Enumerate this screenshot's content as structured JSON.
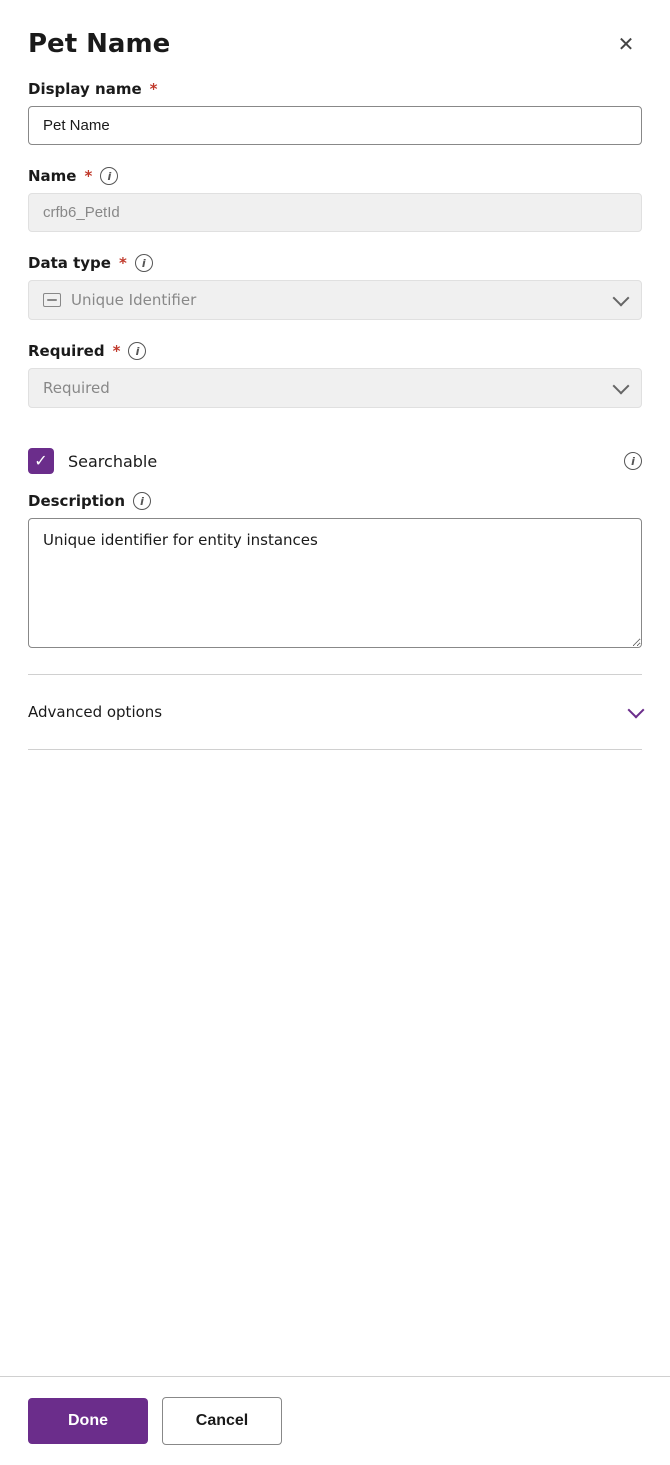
{
  "panel": {
    "title": "Pet Name",
    "close_label": "×"
  },
  "fields": {
    "display_name": {
      "label": "Display name",
      "required": true,
      "value": "Pet Name",
      "placeholder": "Pet Name"
    },
    "name": {
      "label": "Name",
      "required": true,
      "info": true,
      "value": "crfb6_PetId",
      "placeholder": "crfb6_PetId",
      "disabled": true
    },
    "data_type": {
      "label": "Data type",
      "required": true,
      "info": true,
      "value": "Unique Identifier",
      "placeholder": "Unique Identifier"
    },
    "required": {
      "label": "Required",
      "required": true,
      "info": true,
      "value": "Required",
      "placeholder": "Required"
    },
    "searchable": {
      "label": "Searchable",
      "checked": true
    },
    "description": {
      "label": "Description",
      "info": true,
      "value": "Unique identifier for entity instances",
      "placeholder": ""
    },
    "advanced": {
      "label": "Advanced options"
    }
  },
  "footer": {
    "done_label": "Done",
    "cancel_label": "Cancel"
  },
  "icons": {
    "info": "i",
    "close": "✕",
    "check": "✓",
    "chevron": ""
  }
}
